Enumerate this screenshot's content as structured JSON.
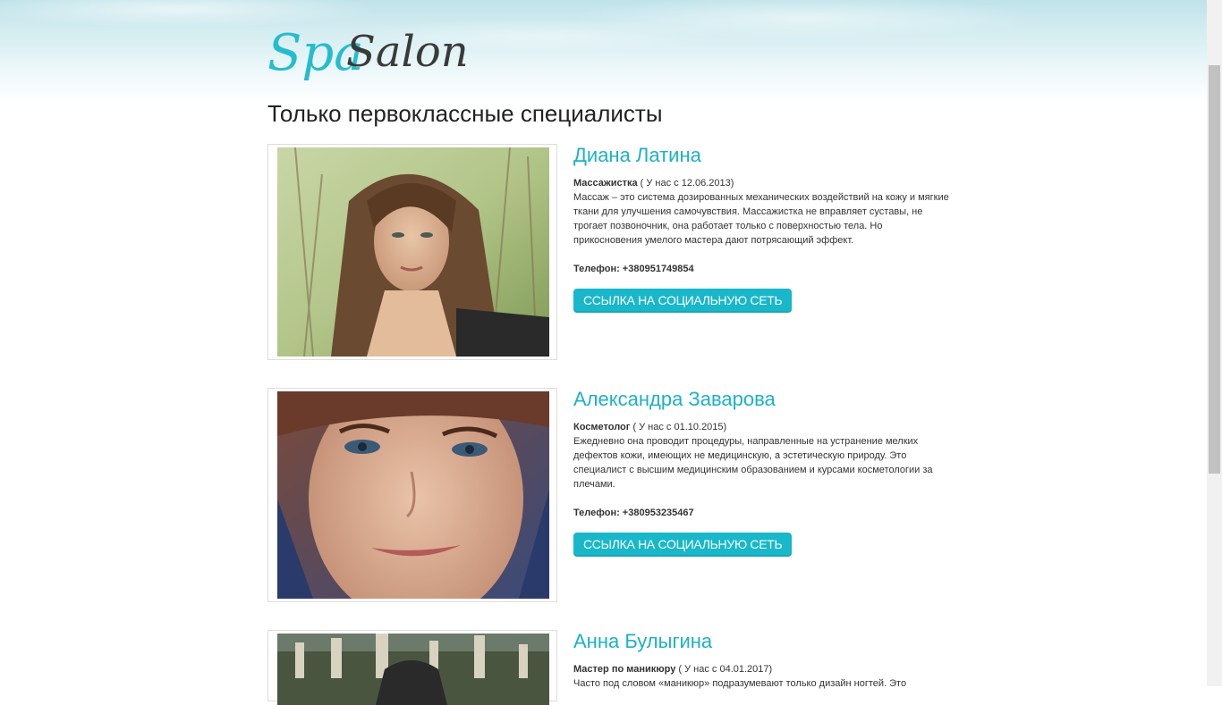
{
  "brand": {
    "logo_part1": "Spa",
    "logo_part2": "Salon"
  },
  "page": {
    "title": "Только первоклассные специалисты"
  },
  "specialists": [
    {
      "name": "Диана Латина",
      "role": "Массажистка",
      "since": " ( У нас с 12.06.2013)",
      "description": "Массаж – это система дозированных механических воздействий на кожу и мягкие ткани для улучшения самочувствия. Массажистка не вправляет суставы, не трогает позвоночник, она работает только с поверхностью тела. Но прикосновения умелого мастера дают потрясающий эффект.",
      "phone": "Телефон: +380951749854",
      "button": "ССЫЛКА НА СОЦИАЛЬНУЮ СЕТЬ"
    },
    {
      "name": "Александра Заварова",
      "role": "Косметолог",
      "since": " ( У нас с 01.10.2015)",
      "description": "Ежедневно она проводит процедуры, направленные на устранение мелких дефектов кожи, имеющих не медицинскую, а эстетическую природу. Это специалист с высшим медицинским образованием и курсами косметологии за плечами.",
      "phone": "Телефон: +380953235467",
      "button": "ССЫЛКА НА СОЦИАЛЬНУЮ СЕТЬ"
    },
    {
      "name": "Анна Булыгина",
      "role": "Мастер по маникюру",
      "since": " ( У нас с 04.01.2017)",
      "description": "Часто под словом «маникюр» подразумевают только дизайн ногтей. Это"
    }
  ],
  "colors": {
    "accent": "#1eb1c4",
    "button": "#18b7c9"
  }
}
